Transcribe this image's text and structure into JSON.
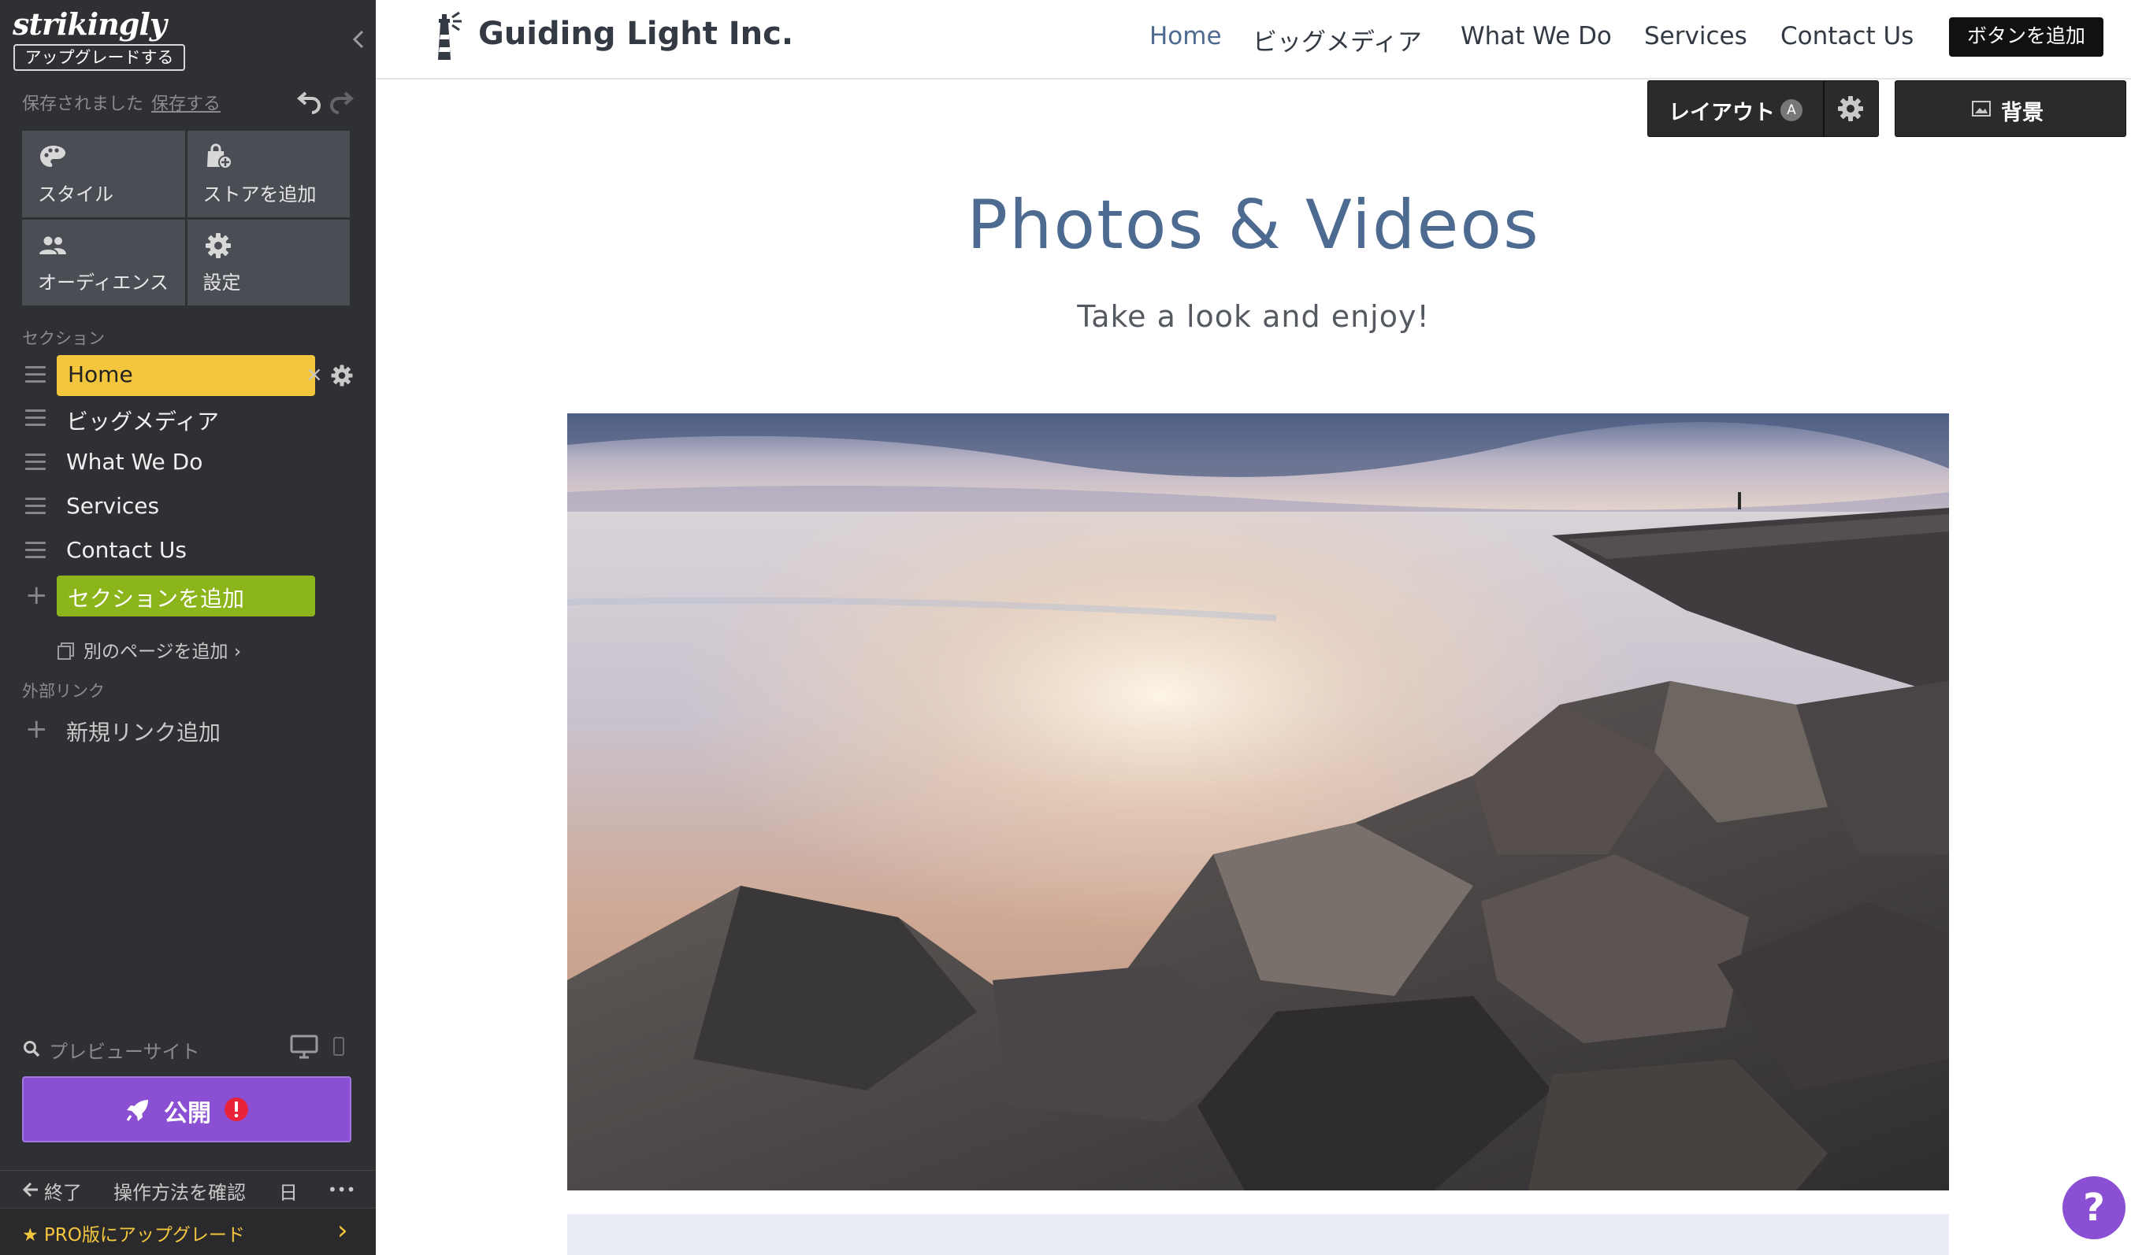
{
  "sidebar": {
    "logo": "strikingly",
    "upgrade_label": "アップグレードする",
    "saved_text": "保存されました",
    "save_link": "保存する",
    "tiles": [
      {
        "label": "スタイル",
        "icon": "palette-icon"
      },
      {
        "label": "ストアを追加",
        "icon": "store-bag-icon"
      },
      {
        "label": "オーディエンス",
        "icon": "audience-icon"
      },
      {
        "label": "設定",
        "icon": "gear-icon"
      }
    ],
    "sections_heading": "セクション",
    "sections": [
      {
        "label": "Home",
        "active": true
      },
      {
        "label": "ビッグメディア"
      },
      {
        "label": "What We Do"
      },
      {
        "label": "Services"
      },
      {
        "label": "Contact Us"
      }
    ],
    "remove_glyph": "×",
    "add_section_label": "セクションを追加",
    "add_page_label": "別のページを追加 ›",
    "external_heading": "外部リンク",
    "add_link_label": "新規リンク追加",
    "preview_label": "プレビューサイト",
    "publish_label": "公開",
    "footer": {
      "exit_label": "終了",
      "help_label": "操作方法を確認",
      "lang_label": "日",
      "more_label": "•••"
    },
    "pro_label": "★ PRO版にアップグレード",
    "pro_chevron": "›"
  },
  "site": {
    "brand": "Guiding Light Inc.",
    "nav": [
      {
        "label": "Home",
        "active": true
      },
      {
        "label": "ビッグメディア"
      },
      {
        "label": "What We Do"
      },
      {
        "label": "Services"
      },
      {
        "label": "Contact Us"
      }
    ],
    "nav_button_label": "ボタンを追加",
    "layout_label": "レイアウト",
    "layout_badge": "A",
    "background_label": "背景",
    "title": "Photos & Videos",
    "subtitle": "Take a look and enjoy!",
    "help_label": "?"
  },
  "colors": {
    "sidebar_bg": "#2f3033",
    "active_section": "#f4c63d",
    "add_section": "#8bb51a",
    "publish": "#8b4fd3",
    "title_blue": "#4d6a91"
  }
}
